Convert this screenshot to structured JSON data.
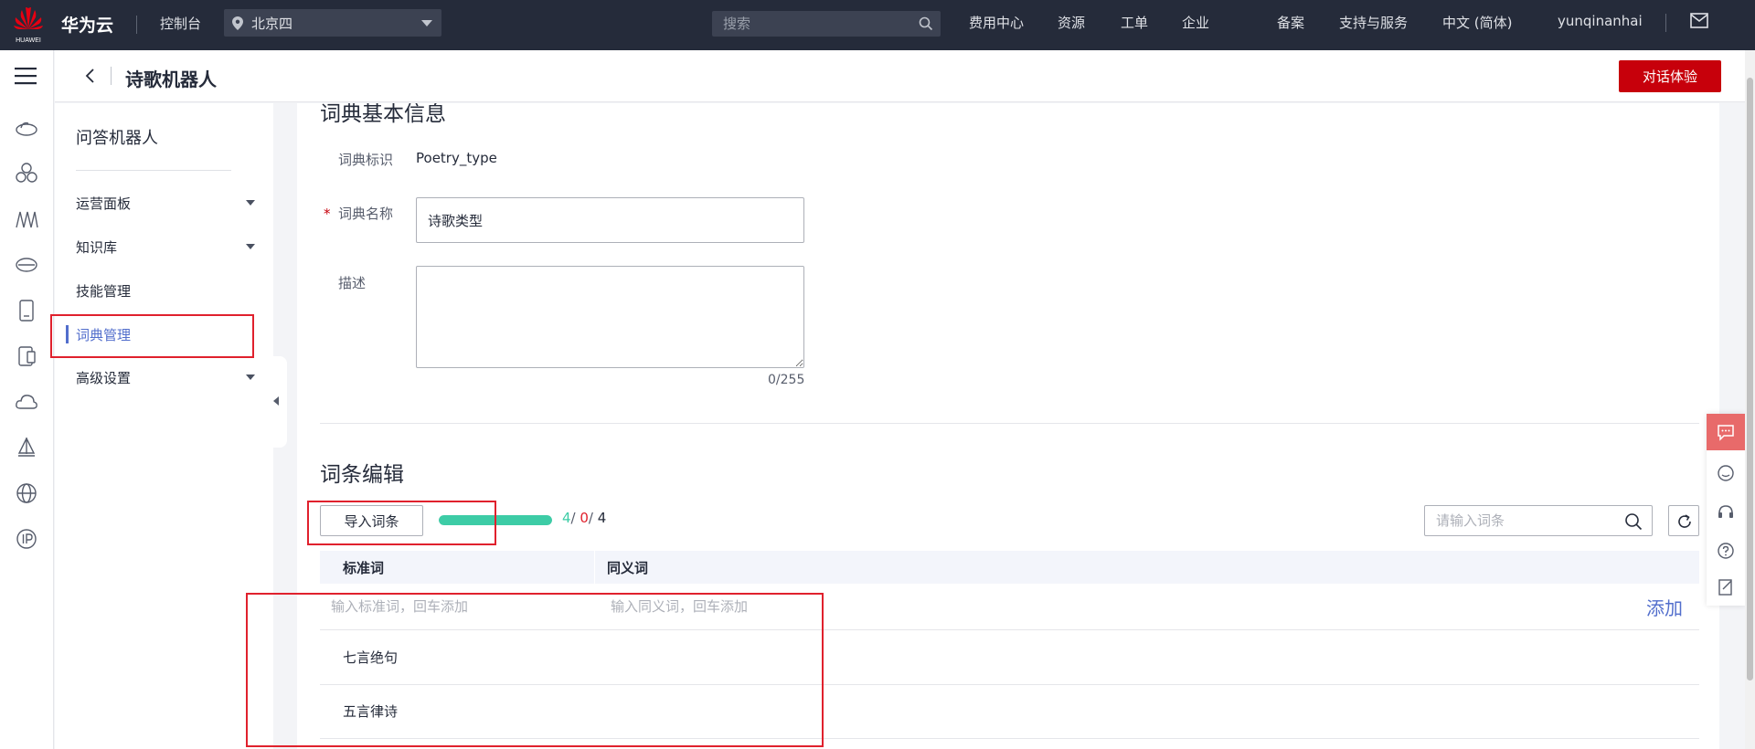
{
  "topbar": {
    "logo_text": "HUAWEI",
    "brand": "华为云",
    "console": "控制台",
    "region": "北京四",
    "search_placeholder": "搜索",
    "nav": [
      "费用中心",
      "资源",
      "工单",
      "企业",
      "备案",
      "支持与服务",
      "中文 (简体)",
      "yunqinanhai"
    ],
    "icons": [
      "location-pin-icon",
      "search-icon",
      "mail-icon"
    ]
  },
  "rail": {
    "icons": [
      "menu-icon",
      "cloud-icon",
      "cluster-icon",
      "chart-icon",
      "server-icon",
      "device-icon",
      "phone-icon",
      "cloud-sync-icon",
      "sailboat-icon",
      "globe-icon",
      "ip-icon"
    ]
  },
  "pageheader": {
    "title": "诗歌机器人",
    "try_button": "对话体验"
  },
  "leftnav": {
    "title": "问答机器人",
    "items": [
      {
        "label": "运营面板",
        "expandable": true,
        "active": false
      },
      {
        "label": "知识库",
        "expandable": true,
        "active": false
      },
      {
        "label": "技能管理",
        "expandable": false,
        "active": false
      },
      {
        "label": "词典管理",
        "expandable": false,
        "active": true
      },
      {
        "label": "高级设置",
        "expandable": true,
        "active": false
      }
    ]
  },
  "basic": {
    "heading": "词典基本信息",
    "id_label": "词典标识",
    "id_value": "Poetry_type",
    "required_mark": "*",
    "name_label": "词典名称",
    "name_value": "诗歌类型",
    "desc_label": "描述",
    "desc_value": "",
    "char_count": "0/255"
  },
  "entries": {
    "heading": "词条编辑",
    "import_button": "导入词条",
    "progress": {
      "success": "4",
      "failed": "0",
      "total": "4",
      "fraction": 1.0
    },
    "search_placeholder": "请输入词条",
    "columns": [
      "标准词",
      "同义词"
    ],
    "std_placeholder": "输入标准词，回车添加",
    "syn_placeholder": "输入同义词，回车添加",
    "add_link": "添加",
    "rows": [
      "七言绝句",
      "五言律诗"
    ]
  },
  "colors": {
    "topbar": "#252b3a",
    "brand_red": "#c7000b",
    "accent_blue": "#526ecc",
    "progress_green": "#3dcca6",
    "annotation_red": "#e0212d"
  }
}
